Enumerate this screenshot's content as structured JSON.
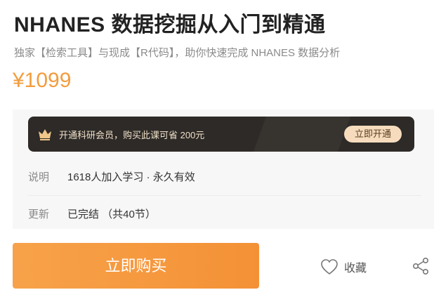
{
  "course": {
    "title": "NHANES 数据挖掘从入门到精通",
    "subtitle": "独家【检索工具】与现成【R代码】，助你快速完成 NHANES 数据分析",
    "price": "¥1099"
  },
  "vip": {
    "text": "开通科研会员，购买此课可省 200元",
    "button_label": "立即开通",
    "icon": "crown-icon"
  },
  "info": {
    "description_label": "说明",
    "description_value": "1618人加入学习 · 永久有效",
    "update_label": "更新",
    "update_value": "已完结 （共40节）"
  },
  "actions": {
    "buy_label": "立即购买",
    "favorite_label": "收藏",
    "favorite_icon": "heart-icon",
    "share_icon": "share-icon"
  },
  "colors": {
    "accent": "#f39c3d",
    "vip_bg": "#2d2a28",
    "vip_button": "#f6dcbd"
  }
}
